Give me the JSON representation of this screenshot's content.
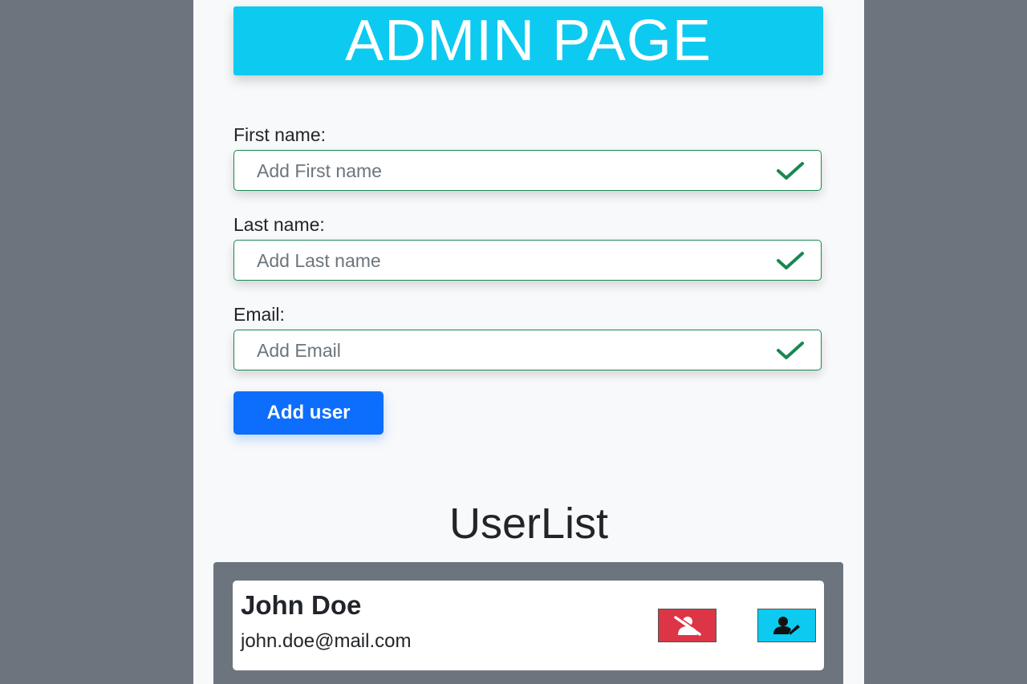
{
  "header": {
    "title": "ADMIN PAGE"
  },
  "form": {
    "first_name": {
      "label": "First name:",
      "placeholder": "Add First name",
      "value": ""
    },
    "last_name": {
      "label": "Last name:",
      "placeholder": "Add Last name",
      "value": ""
    },
    "email": {
      "label": "Email:",
      "placeholder": "Add Email",
      "value": ""
    },
    "submit_label": "Add user",
    "valid_icon": "check-icon"
  },
  "user_list": {
    "title": "UserList",
    "users": [
      {
        "name": "John Doe",
        "email": "john.doe@mail.com",
        "delete_icon": "user-slash-icon",
        "edit_icon": "user-edit-icon"
      }
    ]
  },
  "colors": {
    "banner": "#0dcaf0",
    "primary": "#0d6efd",
    "valid": "#198754",
    "danger": "#dc3545",
    "info": "#0dcaf0",
    "backdrop": "#6c757d"
  }
}
